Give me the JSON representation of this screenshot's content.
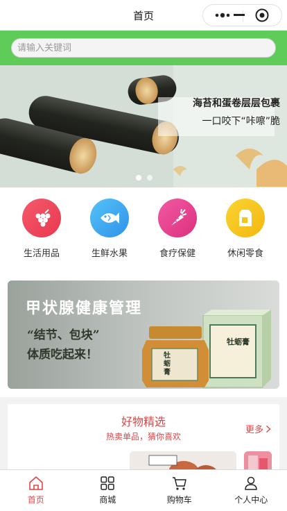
{
  "navbar": {
    "title": "首页"
  },
  "search": {
    "placeholder": "请输入关键词",
    "value": ""
  },
  "banner": {
    "caption_line1": "海苔和蛋卷层层包裹",
    "caption_line2": "一口咬下“咔嚓”脆",
    "slide_count": 2,
    "active_slide": 1
  },
  "categories": [
    {
      "label": "生活用品",
      "icon": "grapes-icon",
      "color": "#ee4b63"
    },
    {
      "label": "生鲜水果",
      "icon": "fish-icon",
      "color": "#3aa5ee"
    },
    {
      "label": "食疗保健",
      "icon": "carrot-icon",
      "color": "#e84591"
    },
    {
      "label": "休闲零食",
      "icon": "milk-box-icon",
      "color": "#f5c319"
    }
  ],
  "promo": {
    "title": "甲状腺健康管理",
    "subtitle1": "“结节、包块”",
    "subtitle2": "体质吃起来！",
    "product_label": "牡蛎膏"
  },
  "featured": {
    "title": "好物精选",
    "subtitle": "热卖单品，猜你喜欢",
    "more_label": "更多"
  },
  "tabs": [
    {
      "label": "首页",
      "icon": "home-icon",
      "active": true
    },
    {
      "label": "商城",
      "icon": "grid-icon",
      "active": false
    },
    {
      "label": "购物车",
      "icon": "cart-icon",
      "active": false
    },
    {
      "label": "个人中心",
      "icon": "user-icon",
      "active": false
    }
  ],
  "colors": {
    "accent": "#e04545",
    "search_band": "#5fcc5a"
  }
}
